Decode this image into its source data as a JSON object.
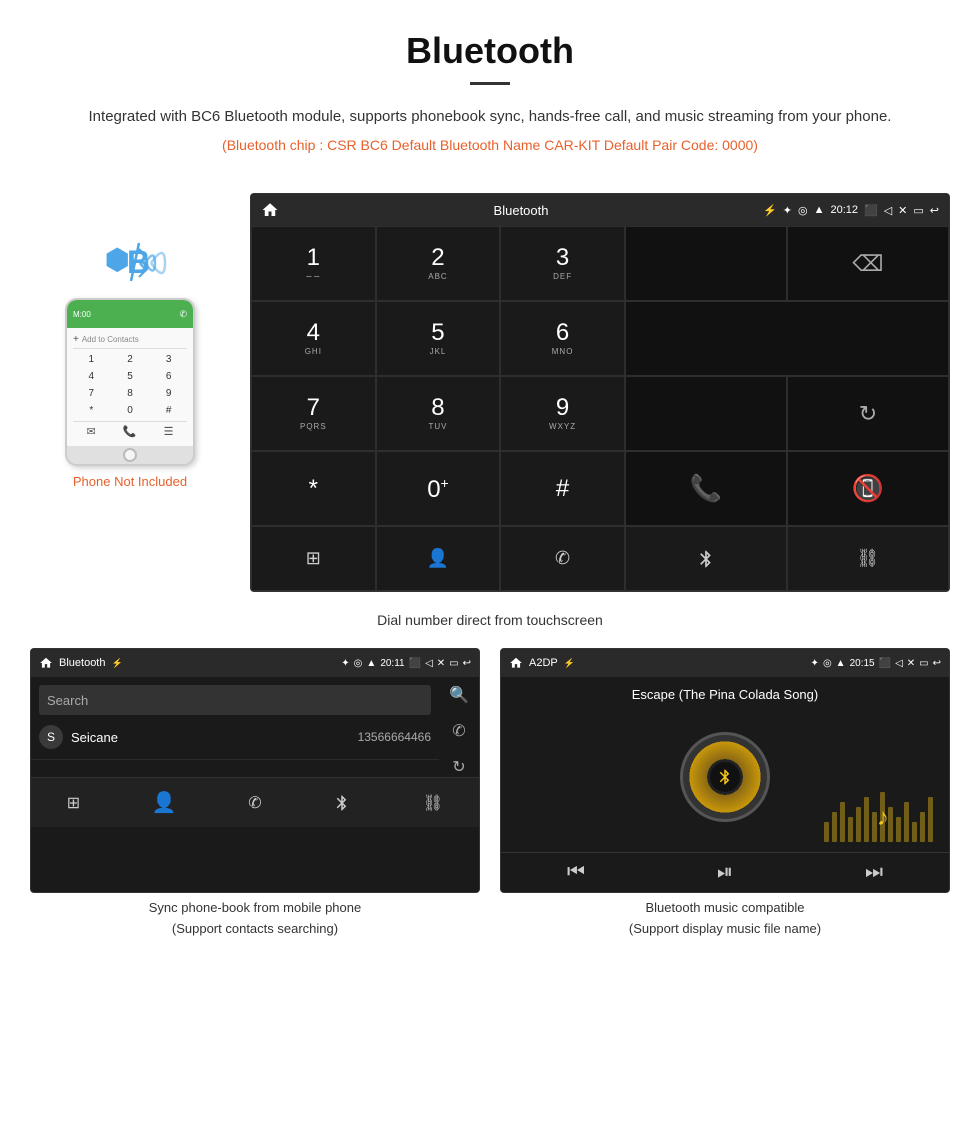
{
  "header": {
    "title": "Bluetooth",
    "description": "Integrated with BC6 Bluetooth module, supports phonebook sync, hands-free call, and music streaming from your phone.",
    "specs": "(Bluetooth chip : CSR BC6   Default Bluetooth Name CAR-KIT    Default Pair Code: 0000)"
  },
  "phone_label": "Phone Not Included",
  "dialpad_screen": {
    "status_center": "Bluetooth",
    "status_time": "20:12",
    "keys": [
      {
        "num": "1",
        "letters": "∽∽"
      },
      {
        "num": "2",
        "letters": "ABC"
      },
      {
        "num": "3",
        "letters": "DEF"
      },
      {
        "num": "4",
        "letters": "GHI"
      },
      {
        "num": "5",
        "letters": "JKL"
      },
      {
        "num": "6",
        "letters": "MNO"
      },
      {
        "num": "7",
        "letters": "PQRS"
      },
      {
        "num": "8",
        "letters": "TUV"
      },
      {
        "num": "9",
        "letters": "WXYZ"
      },
      {
        "num": "*",
        "letters": ""
      },
      {
        "num": "0",
        "letters": "+"
      },
      {
        "num": "#",
        "letters": ""
      }
    ]
  },
  "dial_caption": "Dial number direct from touchscreen",
  "phonebook_panel": {
    "status_center": "Bluetooth",
    "status_time": "20:11",
    "search_placeholder": "Search",
    "contact": {
      "letter": "S",
      "name": "Seicane",
      "number": "13566664466"
    }
  },
  "music_panel": {
    "status_center": "A2DP",
    "status_time": "20:15",
    "song_title": "Escape (The Pina Colada Song)"
  },
  "captions": {
    "phonebook": "Sync phone-book from mobile phone\n(Support contacts searching)",
    "music": "Bluetooth music compatible\n(Support display music file name)"
  },
  "bottom_icons": {
    "grid": "⊞",
    "person": "⚇",
    "phone": "✆",
    "bluetooth": "Ƀ",
    "link": "⛓"
  }
}
